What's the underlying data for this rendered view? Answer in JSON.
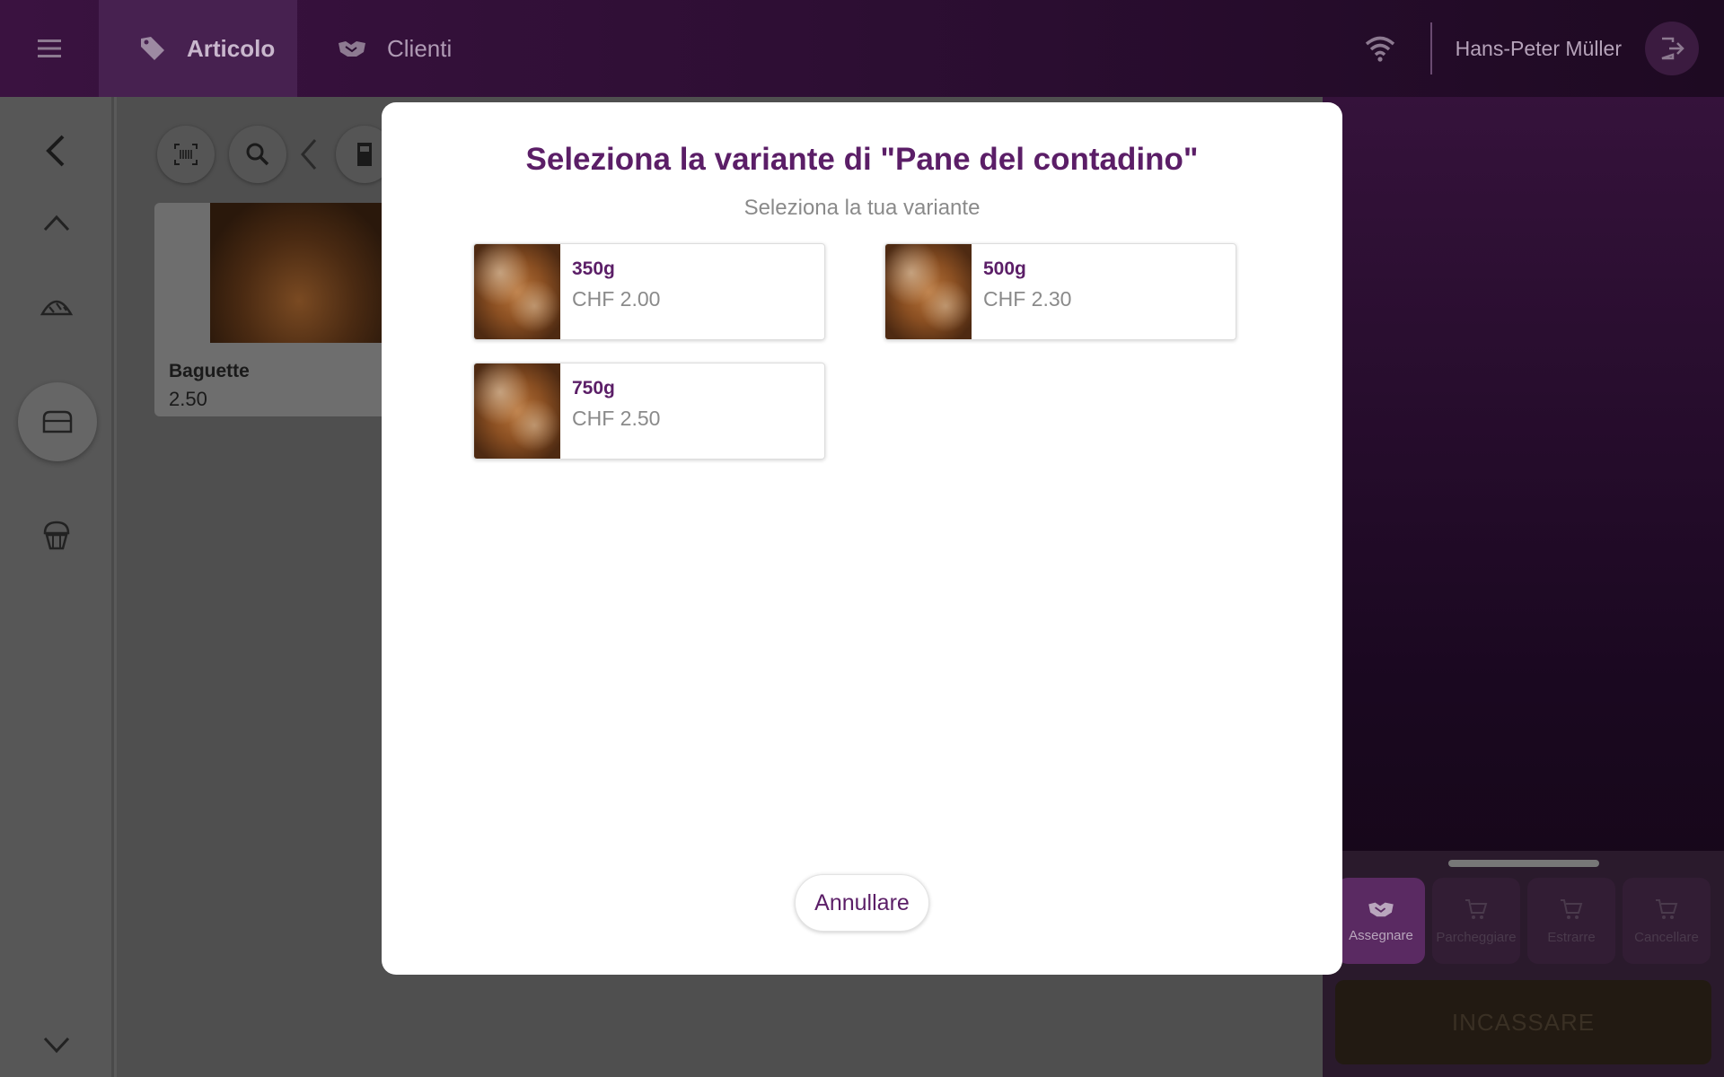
{
  "topbar": {
    "tabs": [
      {
        "label": "Articolo",
        "icon": "tag-icon",
        "active": true
      },
      {
        "label": "Clienti",
        "icon": "handshake-icon",
        "active": false
      }
    ],
    "user_name": "Hans-Peter Müller"
  },
  "products": [
    {
      "name": "Baguette",
      "price": "2.50"
    }
  ],
  "right_panel": {
    "actions": [
      {
        "label": "Assegnare",
        "active": true
      },
      {
        "label": "Parcheggiare",
        "active": false
      },
      {
        "label": "Estrarre",
        "active": false
      },
      {
        "label": "Cancellare",
        "active": false
      }
    ],
    "charge_label": "INCASSARE"
  },
  "modal": {
    "title": "Seleziona la variante di \"Pane del contadino\"",
    "subtitle": "Seleziona la tua variante",
    "variants": [
      {
        "name": "350g",
        "price": "CHF 2.00"
      },
      {
        "name": "500g",
        "price": "CHF 2.30"
      },
      {
        "name": "750g",
        "price": "CHF 2.50"
      }
    ],
    "cancel_label": "Annullare"
  },
  "colors": {
    "brand_purple": "#5b1e67",
    "topbar": "#2a0d30"
  }
}
